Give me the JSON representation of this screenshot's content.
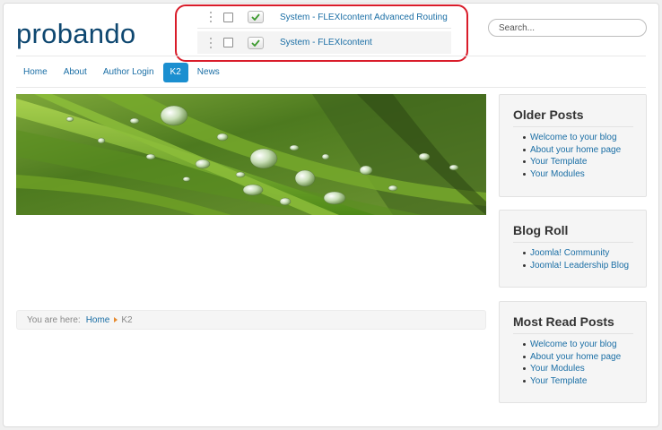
{
  "site": {
    "brand": "probando"
  },
  "plugins": [
    {
      "name": "System - FLEXIcontent Advanced Routing",
      "status": "enabled"
    },
    {
      "name": "System - FLEXIcontent",
      "status": "enabled"
    }
  ],
  "search": {
    "placeholder": "Search..."
  },
  "nav": {
    "items": [
      {
        "label": "Home",
        "active": false
      },
      {
        "label": "About",
        "active": false
      },
      {
        "label": "Author Login",
        "active": false
      },
      {
        "label": "K2",
        "active": true
      },
      {
        "label": "News",
        "active": false
      }
    ]
  },
  "banner": {
    "icon": "water-droplets-on-grass-image"
  },
  "breadcrumb": {
    "prefix": "You are here:",
    "home": "Home",
    "current": "K2"
  },
  "sidebar": {
    "older_posts": {
      "title": "Older Posts",
      "items": [
        "Welcome to your blog",
        "About your home page",
        "Your Template",
        "Your Modules"
      ]
    },
    "blog_roll": {
      "title": "Blog Roll",
      "items": [
        "Joomla! Community",
        "Joomla! Leadership Blog"
      ]
    },
    "most_read": {
      "title": "Most Read Posts",
      "items": [
        "Welcome to your blog",
        "About your home page",
        "Your Modules",
        "Your Template"
      ]
    }
  },
  "colors": {
    "brand": "#0e4770",
    "link": "#1a6ea5",
    "nav_active": "#1b8fd0",
    "highlight": "#d91c2a",
    "check": "#3c9a2f"
  }
}
